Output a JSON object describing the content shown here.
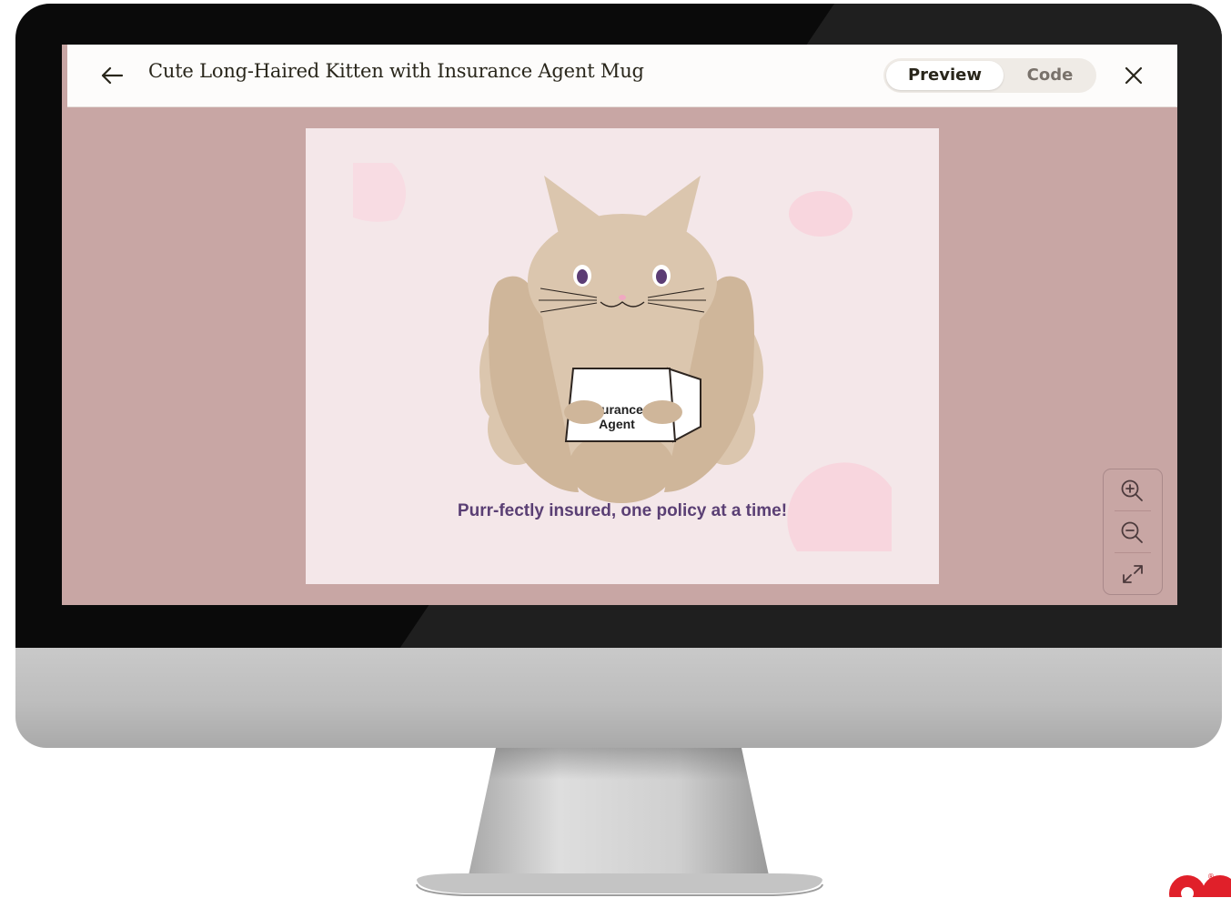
{
  "header": {
    "title": "Cute Long-Haired Kitten with Insurance Agent Mug",
    "toggle": {
      "preview_label": "Preview",
      "code_label": "Code",
      "active": "Preview"
    }
  },
  "artwork": {
    "mug_label_line1": "surance",
    "mug_label_line2": "Agent",
    "tagline": "Purr-fectly insured, one policy at a time!"
  },
  "icons": {
    "back": "arrow-left-icon",
    "close": "close-icon",
    "zoom_in": "zoom-in-icon",
    "zoom_out": "zoom-out-icon",
    "fit": "expand-icon"
  },
  "colors": {
    "screen_background": "#c8a6a4",
    "artwork_background": "#f4e7e9",
    "cat_fur": "#dbc6ae",
    "cat_fur_dark": "#cfb69a",
    "tagline": "#5a3f74",
    "header_background": "#fdfcfb"
  }
}
